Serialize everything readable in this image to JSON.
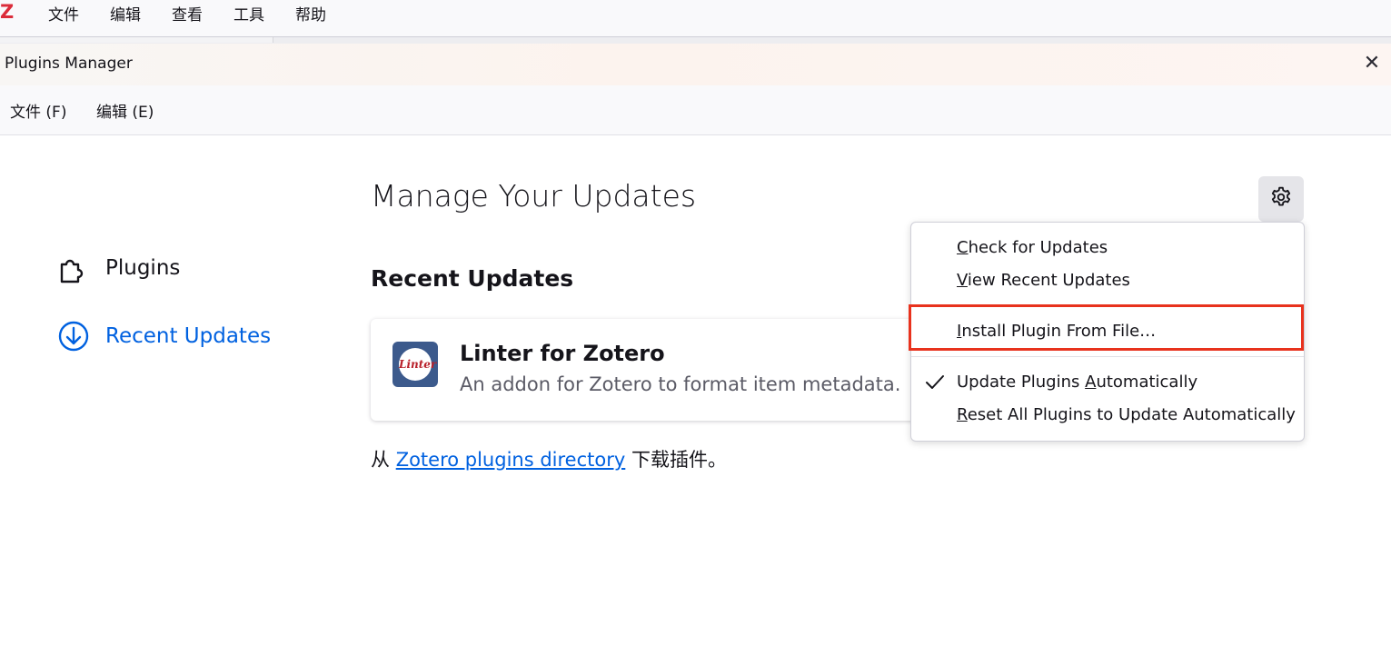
{
  "app": {
    "logo": "Z",
    "menu": [
      "文件",
      "编辑",
      "查看",
      "工具",
      "帮助"
    ]
  },
  "dialog": {
    "title": "Plugins Manager",
    "close": "✕",
    "menu": [
      "文件 (F)",
      "编辑 (E)"
    ]
  },
  "sidebar": {
    "items": [
      {
        "label": "Plugins",
        "icon": "puzzle-icon"
      },
      {
        "label": "Recent Updates",
        "icon": "download-icon"
      }
    ]
  },
  "main": {
    "title": "Manage Your Updates",
    "section_heading": "Recent Updates",
    "addon": {
      "name": "Linter for Zotero",
      "description": "An addon for Zotero to format item metadata.",
      "icon_text": "Linter"
    },
    "footer": {
      "prefix": "从 ",
      "link": "Zotero plugins directory",
      "suffix": " 下载插件。"
    }
  },
  "settings_menu": {
    "items": [
      {
        "pre": "",
        "key": "C",
        "post": "heck for Updates"
      },
      {
        "pre": "",
        "key": "V",
        "post": "iew Recent Updates"
      },
      {
        "pre": "",
        "key": "I",
        "post": "nstall Plugin From File…"
      },
      {
        "pre": "Update Plugins ",
        "key": "A",
        "post": "utomatically",
        "checked": true
      },
      {
        "pre": "",
        "key": "R",
        "post": "eset All Plugins to Update Automatically"
      }
    ]
  },
  "colors": {
    "accent": "#0061e0",
    "highlight": "#e8321d",
    "logo": "#db2c3a"
  }
}
